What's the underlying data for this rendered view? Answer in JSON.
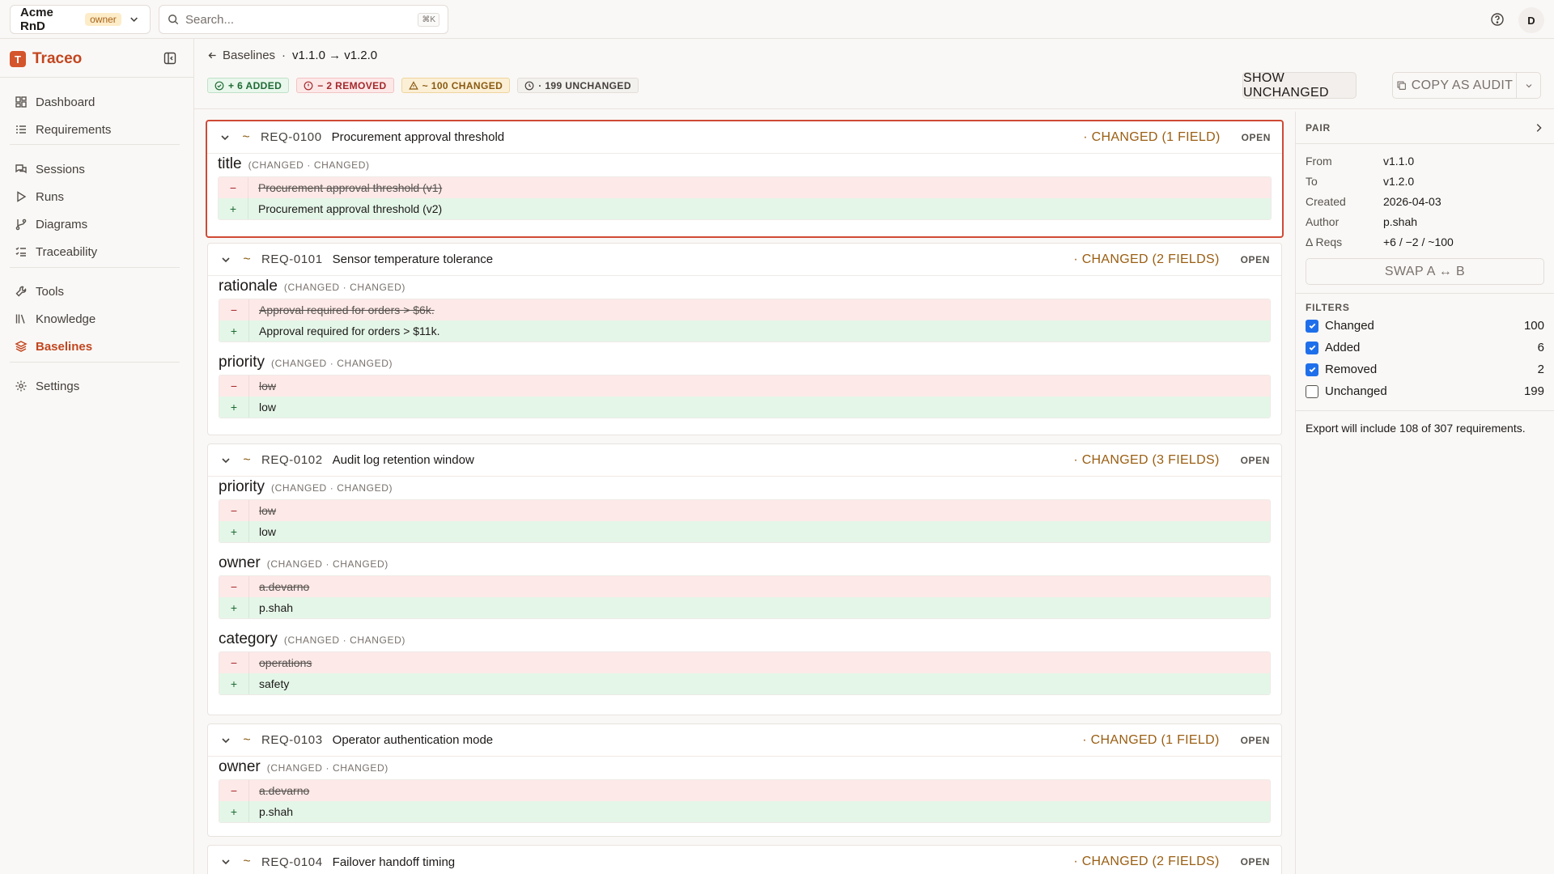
{
  "org": {
    "name": "Acme RnD",
    "role": "owner"
  },
  "search": {
    "placeholder": "Search...",
    "shortcut": "⌘K"
  },
  "user": {
    "initial": "D"
  },
  "brand": {
    "letter": "T",
    "name": "Traceo"
  },
  "nav": [
    {
      "label": "Dashboard",
      "icon": "dashboard-icon"
    },
    {
      "label": "Requirements",
      "icon": "list-icon"
    },
    {
      "label": "Sessions",
      "icon": "chat-icon"
    },
    {
      "label": "Runs",
      "icon": "play-icon"
    },
    {
      "label": "Diagrams",
      "icon": "branch-icon"
    },
    {
      "label": "Traceability",
      "icon": "list-check-icon"
    },
    {
      "label": "Tools",
      "icon": "wrench-icon"
    },
    {
      "label": "Knowledge",
      "icon": "library-icon"
    },
    {
      "label": "Baselines",
      "icon": "layers-icon",
      "active": true
    },
    {
      "label": "Settings",
      "icon": "gear-icon"
    }
  ],
  "breadcrumb": {
    "back": "Baselines",
    "separator": "·",
    "current": "v1.1.0 → v1.2.0"
  },
  "summary": {
    "added": "+ 6 ADDED",
    "removed": "− 2 REMOVED",
    "changed": "~ 100 CHANGED",
    "unchanged": "· 199 UNCHANGED"
  },
  "actions": {
    "show_unchanged": "SHOW UNCHANGED",
    "copy_audit": "COPY AS AUDIT"
  },
  "requirements": [
    {
      "id": "REQ-0100",
      "title": "Procurement approval threshold",
      "status": "· CHANGED (1 FIELD)",
      "open": "OPEN",
      "fields": [
        {
          "name": "title",
          "tag": "(CHANGED · CHANGED)",
          "old": "Procurement approval threshold (v1)",
          "new": "Procurement approval threshold (v2)"
        }
      ]
    },
    {
      "id": "REQ-0101",
      "title": "Sensor temperature tolerance",
      "status": "· CHANGED (2 FIELDS)",
      "open": "OPEN",
      "fields": [
        {
          "name": "rationale",
          "tag": "(CHANGED · CHANGED)",
          "old": "Approval required for orders > $6k.",
          "new": "Approval required for orders > $11k."
        },
        {
          "name": "priority",
          "tag": "(CHANGED · CHANGED)",
          "old": "low",
          "new": "low"
        }
      ]
    },
    {
      "id": "REQ-0102",
      "title": "Audit log retention window",
      "status": "· CHANGED (3 FIELDS)",
      "open": "OPEN",
      "fields": [
        {
          "name": "priority",
          "tag": "(CHANGED · CHANGED)",
          "old": "low",
          "new": "low"
        },
        {
          "name": "owner",
          "tag": "(CHANGED · CHANGED)",
          "old": "a.devarno",
          "new": "p.shah"
        },
        {
          "name": "category",
          "tag": "(CHANGED · CHANGED)",
          "old": "operations",
          "new": "safety"
        }
      ]
    },
    {
      "id": "REQ-0103",
      "title": "Operator authentication mode",
      "status": "· CHANGED (1 FIELD)",
      "open": "OPEN",
      "fields": [
        {
          "name": "owner",
          "tag": "(CHANGED · CHANGED)",
          "old": "a.devarno",
          "new": "p.shah"
        }
      ]
    },
    {
      "id": "REQ-0104",
      "title": "Failover handoff timing",
      "status": "· CHANGED (2 FIELDS)",
      "open": "OPEN",
      "fields": []
    }
  ],
  "pair": {
    "heading": "PAIR",
    "rows": [
      {
        "key": "From",
        "value": "v1.1.0"
      },
      {
        "key": "To",
        "value": "v1.2.0"
      },
      {
        "key": "Created",
        "value": "2026-04-03"
      },
      {
        "key": "Author",
        "value": "p.shah"
      },
      {
        "key": "Δ Reqs",
        "value": "+6 / −2 / ~100"
      }
    ],
    "swap_label": "SWAP A ↔ B"
  },
  "filters": {
    "heading": "FILTERS",
    "items": [
      {
        "label": "Changed",
        "count": "100",
        "checked": true
      },
      {
        "label": "Added",
        "count": "6",
        "checked": true
      },
      {
        "label": "Removed",
        "count": "2",
        "checked": true
      },
      {
        "label": "Unchanged",
        "count": "199",
        "checked": false
      }
    ]
  },
  "export_note": "Export will include 108 of 307 requirements.",
  "colors": {
    "accent": "#c2461f",
    "changed": "#9a5e12",
    "del_bg": "#fde9e8",
    "add_bg": "#e4f6e8",
    "checkbox": "#1f6feb"
  }
}
